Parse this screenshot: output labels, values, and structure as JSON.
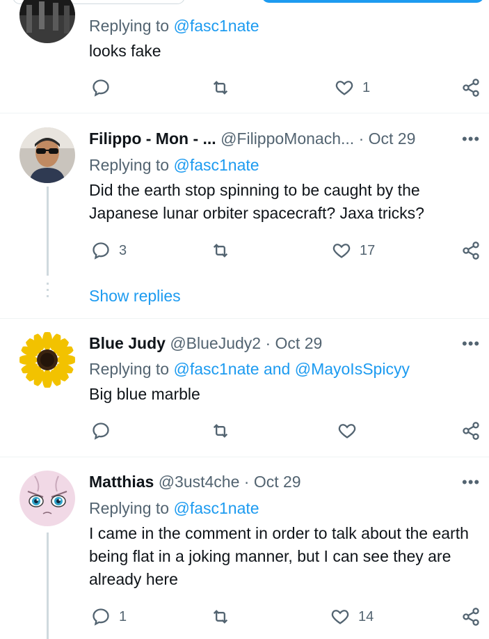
{
  "tweets": [
    {
      "name": "",
      "handle": "",
      "date": "",
      "replying_prefix": "Replying to ",
      "replying_to": "@fasc1nate",
      "text": "looks fake",
      "replies": "",
      "retweets": "",
      "likes": "1"
    },
    {
      "name": "Filippo - Mon - ...",
      "handle": "@FilippoMonach...",
      "separator": "·",
      "date": "Oct 29",
      "replying_prefix": "Replying to ",
      "replying_to": "@fasc1nate",
      "text": "Did the earth stop spinning to be caught by the Japanese lunar orbiter spacecraft? Jaxa tricks?",
      "replies": "3",
      "retweets": "",
      "likes": "17",
      "show_replies": "Show replies"
    },
    {
      "name": "Blue Judy",
      "handle": "@BlueJudy2",
      "separator": "·",
      "date": "Oct 29",
      "replying_prefix": "Replying to ",
      "replying_to": "@fasc1nate",
      "replying_and": " and ",
      "replying_to_2": "@MayoIsSpicyy",
      "text": "Big blue marble",
      "replies": "",
      "retweets": "",
      "likes": ""
    },
    {
      "name": "Matthias",
      "handle": "@3ust4che",
      "separator": "·",
      "date": "Oct 29",
      "replying_prefix": "Replying to ",
      "replying_to": "@fasc1nate",
      "text": "I came in the comment in order to talk about the earth being flat in a joking manner, but I can see they are already here",
      "replies": "1",
      "retweets": "",
      "likes": "14"
    }
  ],
  "more_glyph": "•••",
  "icons": {
    "reply": "reply-icon",
    "retweet": "retweet-icon",
    "like": "heart-icon",
    "share": "share-icon",
    "more": "more-icon"
  },
  "colors": {
    "accent": "#1d9bf0",
    "muted": "#536471",
    "text": "#0f1419",
    "divider": "#eff3f4"
  }
}
